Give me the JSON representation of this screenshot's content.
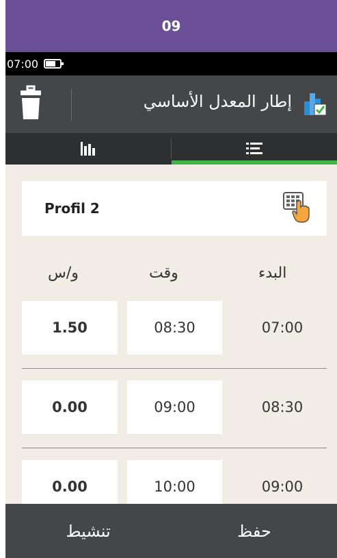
{
  "topbar": {
    "label": "09"
  },
  "status": {
    "time": "07:00",
    "battery_level": 0.65
  },
  "header": {
    "title": "إطار المعدل الأساسي",
    "icons": [
      "trash-icon",
      "basal-rate-app-icon"
    ]
  },
  "tabs": [
    {
      "icon": "bar-chart-icon",
      "active": false
    },
    {
      "icon": "list-icon",
      "active": true
    }
  ],
  "colors": {
    "accent": "#3fb549",
    "topbar": "#6a4f96",
    "header": "#444648",
    "content_bg": "#f1ede4"
  },
  "profile": {
    "name": "Profil 2",
    "icon": "keypad-touch-icon"
  },
  "columns": {
    "start": "البدء",
    "end": "وقت",
    "rate": "و/س"
  },
  "rows": [
    {
      "start": "07:00",
      "end": "08:30",
      "rate": "1.50"
    },
    {
      "start": "08:30",
      "end": "09:00",
      "rate": "0.00"
    },
    {
      "start": "09:00",
      "end": "10:00",
      "rate": "0.00"
    }
  ],
  "bottom": {
    "left": "تنشيط",
    "right": "حفظ"
  }
}
